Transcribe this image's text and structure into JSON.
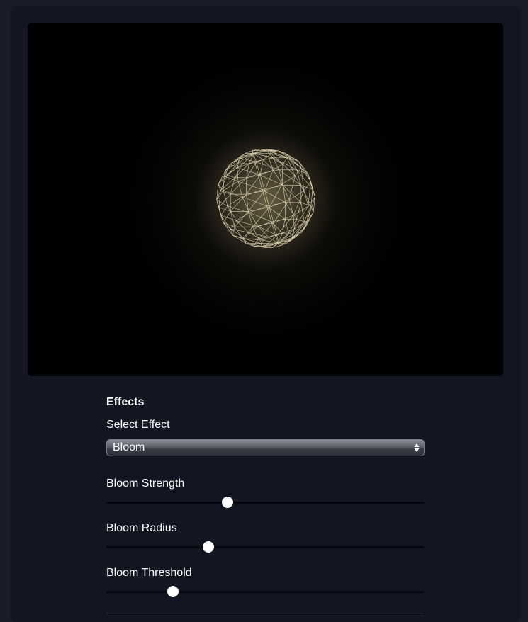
{
  "effects": {
    "title": "Effects",
    "select_label": "Select Effect",
    "selected": "Bloom"
  },
  "sliders": [
    {
      "label": "Bloom Strength",
      "value": 0.38
    },
    {
      "label": "Bloom Radius",
      "value": 0.32
    },
    {
      "label": "Bloom Threshold",
      "value": 0.21
    }
  ],
  "colors": {
    "background": "#181c27",
    "panel": "#121622",
    "viewport": "#000000",
    "wireframe": "#f3e6c0",
    "thumb": "#ffffff"
  }
}
